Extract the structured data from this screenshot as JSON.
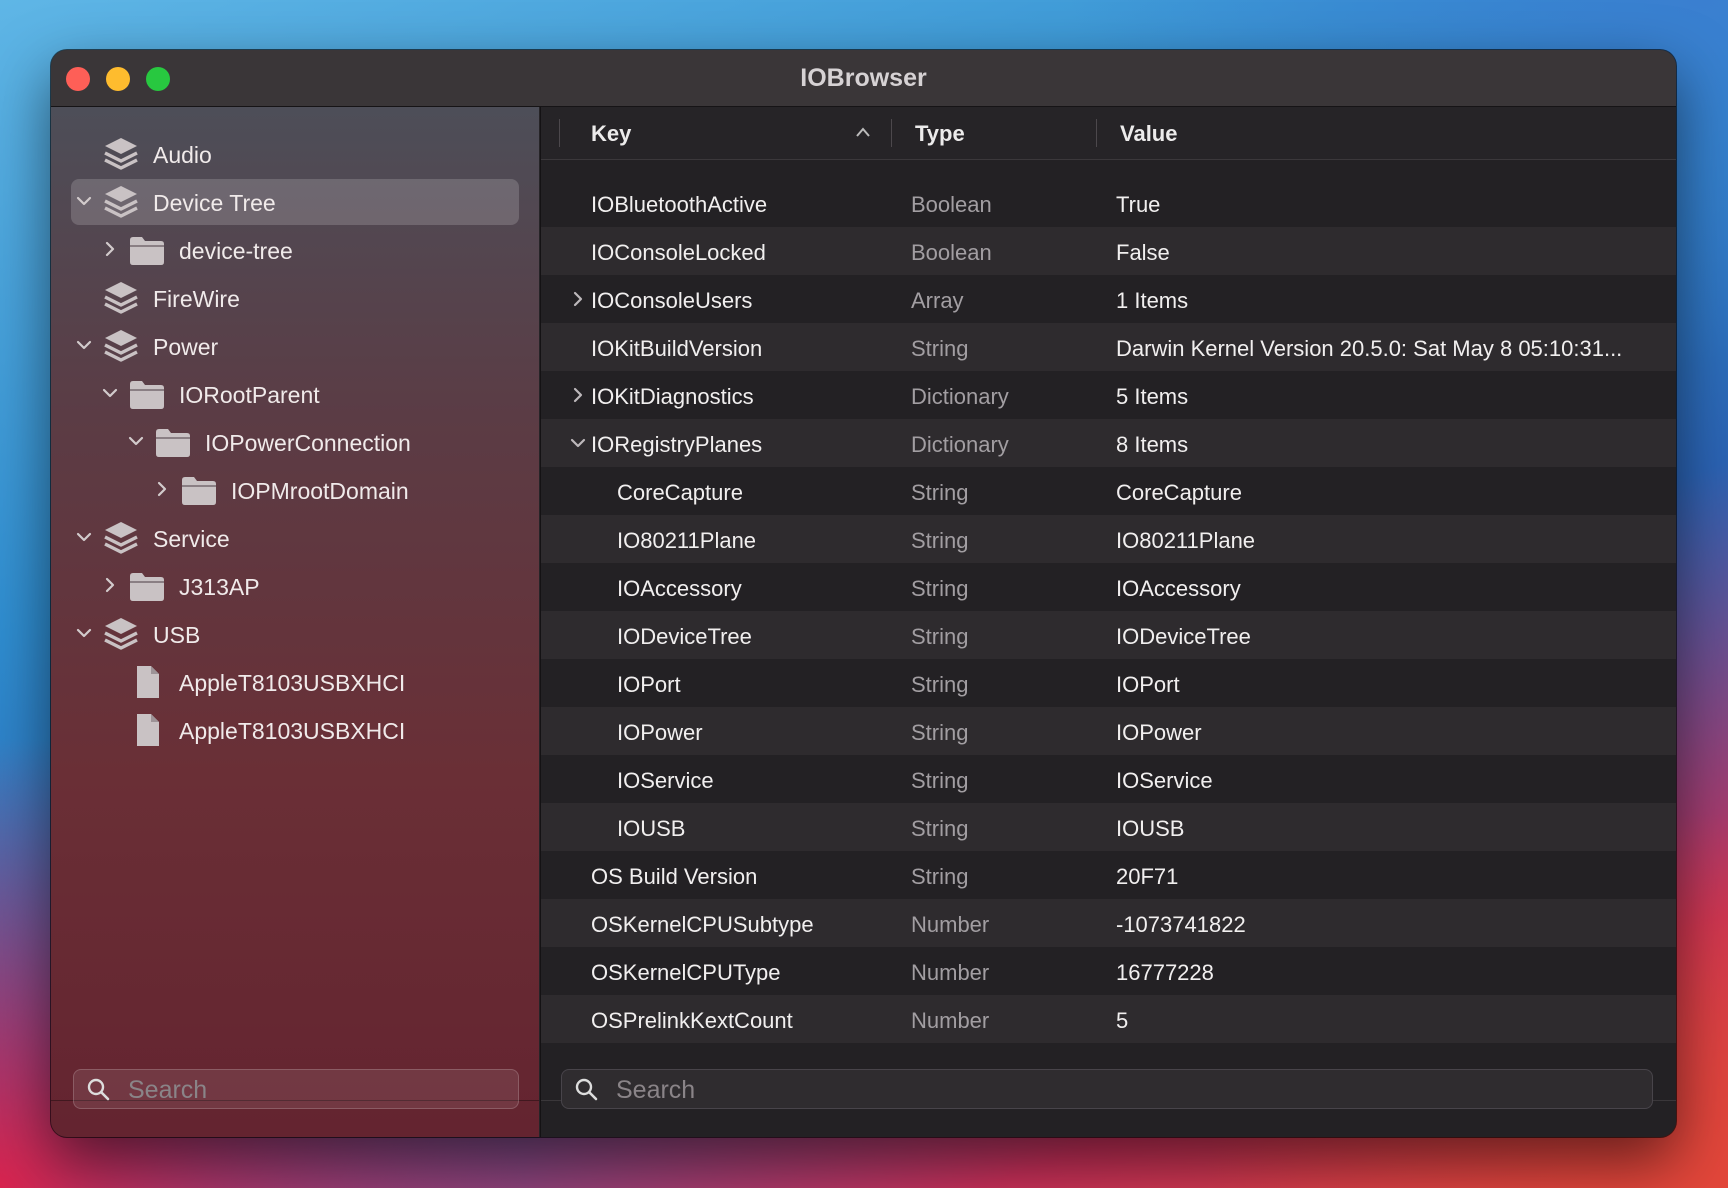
{
  "window": {
    "title": "IOBrowser"
  },
  "sidebar": {
    "search_placeholder": "Search",
    "items": [
      {
        "label": "Audio",
        "icon": "layers-icon",
        "indent": 0,
        "disclosure": "none",
        "selected": false
      },
      {
        "label": "Device Tree",
        "icon": "layers-icon",
        "indent": 0,
        "disclosure": "expanded",
        "selected": true
      },
      {
        "label": "device-tree",
        "icon": "folder-icon",
        "indent": 1,
        "disclosure": "collapsed",
        "selected": false
      },
      {
        "label": "FireWire",
        "icon": "layers-icon",
        "indent": 0,
        "disclosure": "none",
        "selected": false
      },
      {
        "label": "Power",
        "icon": "layers-icon",
        "indent": 0,
        "disclosure": "expanded",
        "selected": false
      },
      {
        "label": "IORootParent",
        "icon": "folder-icon",
        "indent": 1,
        "disclosure": "expanded",
        "selected": false
      },
      {
        "label": "IOPowerConnection",
        "icon": "folder-icon",
        "indent": 2,
        "disclosure": "expanded",
        "selected": false
      },
      {
        "label": "IOPMrootDomain",
        "icon": "folder-icon",
        "indent": 3,
        "disclosure": "collapsed",
        "selected": false
      },
      {
        "label": "Service",
        "icon": "layers-icon",
        "indent": 0,
        "disclosure": "expanded",
        "selected": false
      },
      {
        "label": "J313AP",
        "icon": "folder-icon",
        "indent": 1,
        "disclosure": "collapsed",
        "selected": false
      },
      {
        "label": "USB",
        "icon": "layers-icon",
        "indent": 0,
        "disclosure": "expanded",
        "selected": false
      },
      {
        "label": "AppleT8103USBXHCI",
        "icon": "document-icon",
        "indent": 1,
        "disclosure": "none",
        "selected": false
      },
      {
        "label": "AppleT8103USBXHCI",
        "icon": "document-icon",
        "indent": 1,
        "disclosure": "none",
        "selected": false
      }
    ]
  },
  "table": {
    "columns": {
      "key": "Key",
      "type": "Type",
      "value": "Value"
    },
    "sort": {
      "column": "Key",
      "direction": "ascending"
    },
    "search_placeholder": "Search",
    "rows": [
      {
        "key": "IOBluetoothActive",
        "type": "Boolean",
        "value": "True",
        "indent": 0,
        "disclosure": "none"
      },
      {
        "key": "IOConsoleLocked",
        "type": "Boolean",
        "value": "False",
        "indent": 0,
        "disclosure": "none"
      },
      {
        "key": "IOConsoleUsers",
        "type": "Array",
        "value": "1 Items",
        "indent": 0,
        "disclosure": "collapsed"
      },
      {
        "key": "IOKitBuildVersion",
        "type": "String",
        "value": "Darwin Kernel Version 20.5.0: Sat May  8 05:10:31...",
        "indent": 0,
        "disclosure": "none"
      },
      {
        "key": "IOKitDiagnostics",
        "type": "Dictionary",
        "value": "5 Items",
        "indent": 0,
        "disclosure": "collapsed"
      },
      {
        "key": "IORegistryPlanes",
        "type": "Dictionary",
        "value": "8 Items",
        "indent": 0,
        "disclosure": "expanded"
      },
      {
        "key": "CoreCapture",
        "type": "String",
        "value": "CoreCapture",
        "indent": 1,
        "disclosure": "none"
      },
      {
        "key": "IO80211Plane",
        "type": "String",
        "value": "IO80211Plane",
        "indent": 1,
        "disclosure": "none"
      },
      {
        "key": "IOAccessory",
        "type": "String",
        "value": "IOAccessory",
        "indent": 1,
        "disclosure": "none"
      },
      {
        "key": "IODeviceTree",
        "type": "String",
        "value": "IODeviceTree",
        "indent": 1,
        "disclosure": "none"
      },
      {
        "key": "IOPort",
        "type": "String",
        "value": "IOPort",
        "indent": 1,
        "disclosure": "none"
      },
      {
        "key": "IOPower",
        "type": "String",
        "value": "IOPower",
        "indent": 1,
        "disclosure": "none"
      },
      {
        "key": "IOService",
        "type": "String",
        "value": "IOService",
        "indent": 1,
        "disclosure": "none"
      },
      {
        "key": "IOUSB",
        "type": "String",
        "value": "IOUSB",
        "indent": 1,
        "disclosure": "none"
      },
      {
        "key": "OS Build Version",
        "type": "String",
        "value": "20F71",
        "indent": 0,
        "disclosure": "none"
      },
      {
        "key": "OSKernelCPUSubtype",
        "type": "Number",
        "value": "-1073741822",
        "indent": 0,
        "disclosure": "none"
      },
      {
        "key": "OSKernelCPUType",
        "type": "Number",
        "value": "16777228",
        "indent": 0,
        "disclosure": "none"
      },
      {
        "key": "OSPrelinkKextCount",
        "type": "Number",
        "value": "5",
        "indent": 0,
        "disclosure": "none"
      }
    ]
  }
}
